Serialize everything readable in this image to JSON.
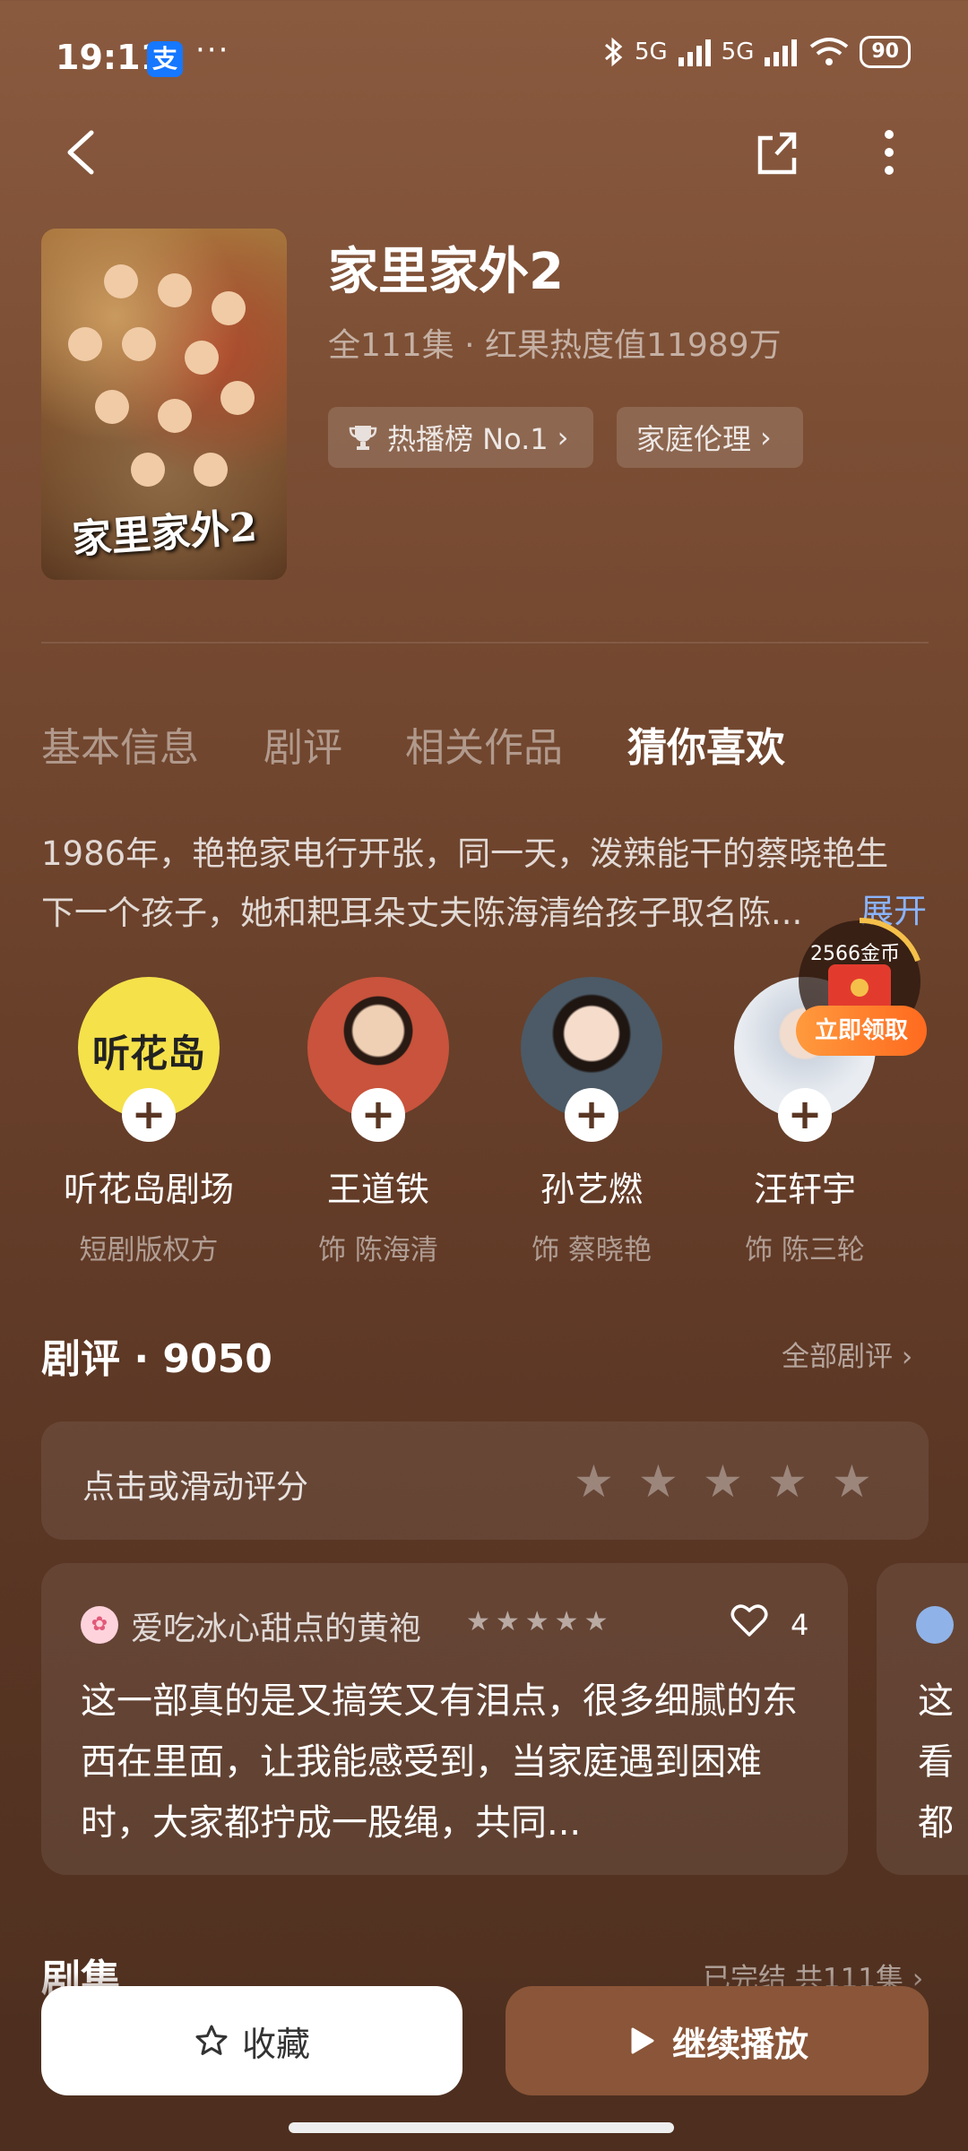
{
  "status_bar": {
    "time": "19:11",
    "alipay_badge": "支",
    "dots": "···",
    "signal1": "5G",
    "signal2": "5G",
    "battery": "90"
  },
  "header": {
    "title": "家里家外2",
    "meta": "全111集 · 红果热度值11989万",
    "rank_chip": "热播榜 No.1",
    "genre_chip": "家庭伦理",
    "poster_title": "家里家外2"
  },
  "tabs": [
    {
      "label": "基本信息"
    },
    {
      "label": "剧评"
    },
    {
      "label": "相关作品"
    },
    {
      "label": "猜你喜欢"
    }
  ],
  "synopsis": {
    "line1": "1986年，艳艳家电行开张，同一天，泼辣能干的蔡晓艳生",
    "line2": "下一个孩子，她和耙耳朵丈夫陈海清给孩子取名陈...",
    "expand": "展开"
  },
  "cast": [
    {
      "name": "听花岛剧场",
      "role": "短剧版权方",
      "logo": "听花岛"
    },
    {
      "name": "王道铁",
      "role": "饰 陈海清"
    },
    {
      "name": "孙艺燃",
      "role": "饰 蔡晓艳"
    },
    {
      "name": "汪轩宇",
      "role": "饰 陈三轮"
    }
  ],
  "coin_badge": {
    "amount": "2566金币",
    "claim": "立即领取"
  },
  "reviews_section": {
    "heading": "剧评 · 9050",
    "all_link": "全部剧评 ›",
    "rate_label": "点击或滑动评分",
    "cards": [
      {
        "author": "爱吃冰心甜点的黄袍",
        "stars": "★★★★★",
        "likes": "4",
        "text": "这一部真的是又搞笑又有泪点，很多细腻的东西在里面，让我能感受到，当家庭遇到困难时，大家都拧成一股绳，共同..."
      },
      {
        "text_partial": "这\n看\n都"
      }
    ]
  },
  "episodes": {
    "heading": "剧集",
    "status": "已完结 共111集 ›"
  },
  "bottom": {
    "collect": "收藏",
    "play": "继续播放"
  },
  "colors": {
    "accent": "#8a5538",
    "link": "#8ab4ff",
    "coin": "#ff7a2a"
  }
}
